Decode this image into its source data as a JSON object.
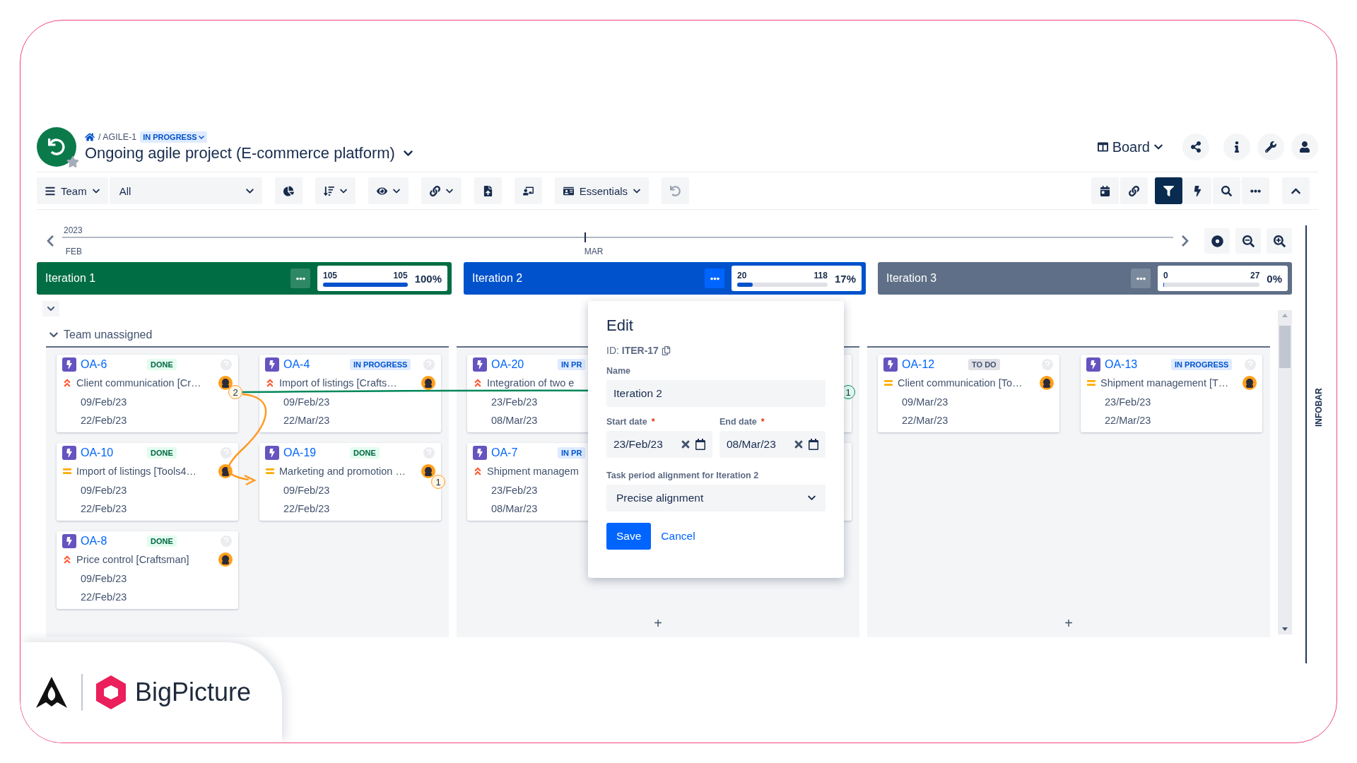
{
  "header": {
    "breadcrumb": "/ AGILE-1",
    "status": "IN PROGRESS",
    "title": "Ongoing agile project (E-commerce platform)",
    "view": "Board"
  },
  "toolbar": {
    "group_by": "Team",
    "filter": "All",
    "view_preset": "Essentials",
    "filter_active": true
  },
  "timeline": {
    "year": "2023",
    "months": [
      "FEB",
      "MAR"
    ]
  },
  "iterations": [
    {
      "name": "Iteration 1",
      "color": "#006d44",
      "done": "105",
      "total": "105",
      "percent": "100%",
      "level": 1,
      "selected": false
    },
    {
      "name": "Iteration 2",
      "color": "#0052cc",
      "done": "20",
      "total": "118",
      "percent": "17%",
      "level": 0.17,
      "selected": true
    },
    {
      "name": "Iteration 3",
      "color": "#5e6f87",
      "done": "0",
      "total": "27",
      "percent": "0%",
      "level": 0,
      "selected": false
    }
  ],
  "group": {
    "name": "Team unassigned",
    "expanded": true
  },
  "columns": [
    {
      "cards": [
        {
          "kind": "task",
          "key": "OA-6",
          "status": {
            "label": "DONE",
            "color": "#e3fcef"
          },
          "priority": {
            "kind": "high"
          },
          "summary": "Client communication [Cr…",
          "start": "09/Feb/23",
          "end": "22/Feb/23"
        },
        {
          "kind": "task",
          "key": "OA-4",
          "status": {
            "label": "IN PROGRESS",
            "color": "#deebff"
          },
          "priority": {
            "kind": "high"
          },
          "summary": "Import of listings [Crafts…",
          "start": "09/Feb/23",
          "end": "22/Mar/23"
        },
        {
          "kind": "task",
          "key": "OA-10",
          "status": {
            "label": "DONE",
            "color": "#e3fcef"
          },
          "priority": {
            "kind": "medium"
          },
          "summary": "Import of listings [Tools4…",
          "start": "09/Feb/23",
          "end": "22/Feb/23"
        },
        {
          "kind": "task",
          "key": "OA-19",
          "status": {
            "label": "DONE",
            "color": "#e3fcef"
          },
          "priority": {
            "kind": "medium"
          },
          "summary": "Marketing and promotion …",
          "start": "09/Feb/23",
          "end": "22/Feb/23"
        },
        {
          "kind": "task",
          "key": "OA-8",
          "status": {
            "label": "DONE",
            "color": "#e3fcef"
          },
          "priority": {
            "kind": "high"
          },
          "summary": "Price control [Craftsman]",
          "start": "09/Feb/23",
          "end": "22/Feb/23"
        }
      ]
    },
    {
      "add_label": "+",
      "cards": [
        {
          "kind": "clipped",
          "key": "OA-20",
          "status": {
            "label": "IN PR",
            "color": "#deebff"
          },
          "priority": {
            "kind": "high"
          },
          "summary": "Integration of two e",
          "start": "23/Feb/23",
          "end": "08/Mar/23"
        },
        {
          "kind": "covered"
        },
        {
          "kind": "clipped",
          "key": "OA-7",
          "status": {
            "label": "IN PR",
            "color": "#deebff"
          },
          "priority": {
            "kind": "high"
          },
          "summary": "Shipment managem",
          "start": "23/Feb/23",
          "end": "08/Mar/23"
        },
        {
          "kind": "covered"
        }
      ]
    },
    {
      "add_label": "+",
      "cards": [
        {
          "kind": "task",
          "key": "OA-12",
          "status": {
            "label": "TO DO",
            "color": "#dfe1e6"
          },
          "priority": {
            "kind": "medium"
          },
          "summary": "Client communication [To…",
          "start": "09/Mar/23",
          "end": "22/Mar/23"
        },
        {
          "kind": "task",
          "key": "OA-13",
          "status": {
            "label": "IN PROGRESS",
            "color": "#deebff"
          },
          "priority": {
            "kind": "medium"
          },
          "summary": "Shipment management [T…",
          "start": "23/Feb/23",
          "end": "22/Mar/23"
        }
      ]
    }
  ],
  "links": [
    {
      "label": "2",
      "color": "#ff991f"
    },
    {
      "label": "1",
      "color": "#ff991f"
    },
    {
      "label": "1",
      "color": "#00875a"
    }
  ],
  "dialog": {
    "title": "Edit",
    "id": "ID: **ITER-17**",
    "name_label": "Name",
    "name_value": "Iteration 2",
    "start_label": "Start date",
    "start_value": "23/Feb/23",
    "end_label": "End date",
    "end_value": "08/Mar/23",
    "required_mark": "*",
    "alignment_label": "Task period alignment for Iteration 2",
    "alignment_value": "Precise alignment",
    "save": "Save",
    "cancel": "Cancel"
  },
  "infobar": "INFOBAR",
  "brand": {
    "name": "BigPicture"
  }
}
